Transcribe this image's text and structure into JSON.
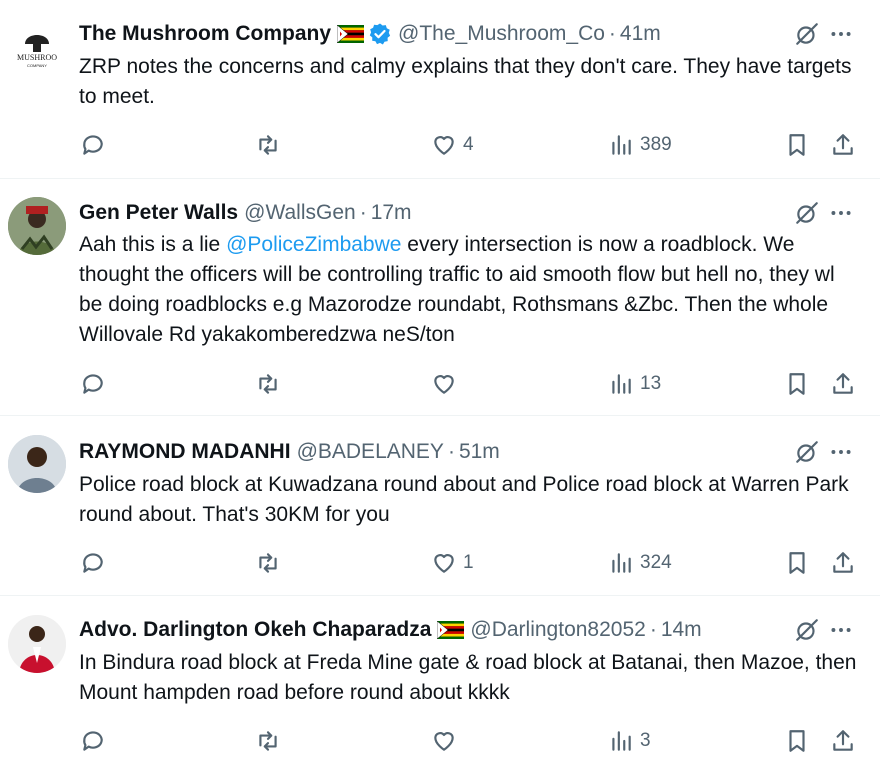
{
  "colors": {
    "text_primary": "#0f1419",
    "text_secondary": "#536471",
    "link": "#1d9bf0",
    "divider": "#eff3f4",
    "verified": "#1d9bf0"
  },
  "tweets": [
    {
      "name": "The Mushroom Company",
      "flag": "zimbabwe-flag",
      "verified": true,
      "handle": "@The_Mushroom_Co",
      "sep": "·",
      "time": "41m",
      "avatar_logo_text": "THE MUSHROOM COMPANY",
      "text_before": "ZRP notes the concerns and calmy explains that they don't care. They have targets to meet.",
      "mention": "",
      "text_after": "",
      "replies": "",
      "retweets": "",
      "likes": "4",
      "views": "389"
    },
    {
      "name": "Gen Peter Walls",
      "flag": "",
      "verified": false,
      "handle": "@WallsGen",
      "sep": "·",
      "time": "17m",
      "text_before": "Aah this is a lie ",
      "mention": "@PoliceZimbabwe",
      "text_after": " every intersection is now a roadblock. We thought the officers will be controlling traffic to aid smooth flow  but hell no, they wl be doing roadblocks e.g Mazorodze roundabt, Rothsmans &Zbc. Then the whole Willovale Rd yakakomberedzwa neS/ton",
      "replies": "",
      "retweets": "",
      "likes": "",
      "views": "13"
    },
    {
      "name": "RAYMOND MADANHI",
      "flag": "",
      "verified": false,
      "handle": "@BADELANEY",
      "sep": "·",
      "time": "51m",
      "text_before": "Police road block at Kuwadzana round about and Police road block at Warren Park round about. That's 30KM for you",
      "mention": "",
      "text_after": "",
      "replies": "",
      "retweets": "",
      "likes": "1",
      "views": "324"
    },
    {
      "name": "Advo. Darlington Okeh Chaparadza",
      "flag": "zimbabwe-flag",
      "verified": false,
      "handle": "@Darlington82052",
      "sep": "·",
      "time": "14m",
      "text_before": "In Bindura road block at Freda Mine gate & road block at Batanai, then Mazoe, then Mount hampden road before round about kkkk",
      "mention": "",
      "text_after": "",
      "replies": "",
      "retweets": "",
      "likes": "",
      "views": "3"
    }
  ],
  "icons": {
    "reply": "reply-icon",
    "retweet": "retweet-icon",
    "like": "heart-icon",
    "views": "views-icon",
    "bookmark": "bookmark-icon",
    "share": "share-icon",
    "grok": "grok-icon",
    "more": "more-icon"
  }
}
